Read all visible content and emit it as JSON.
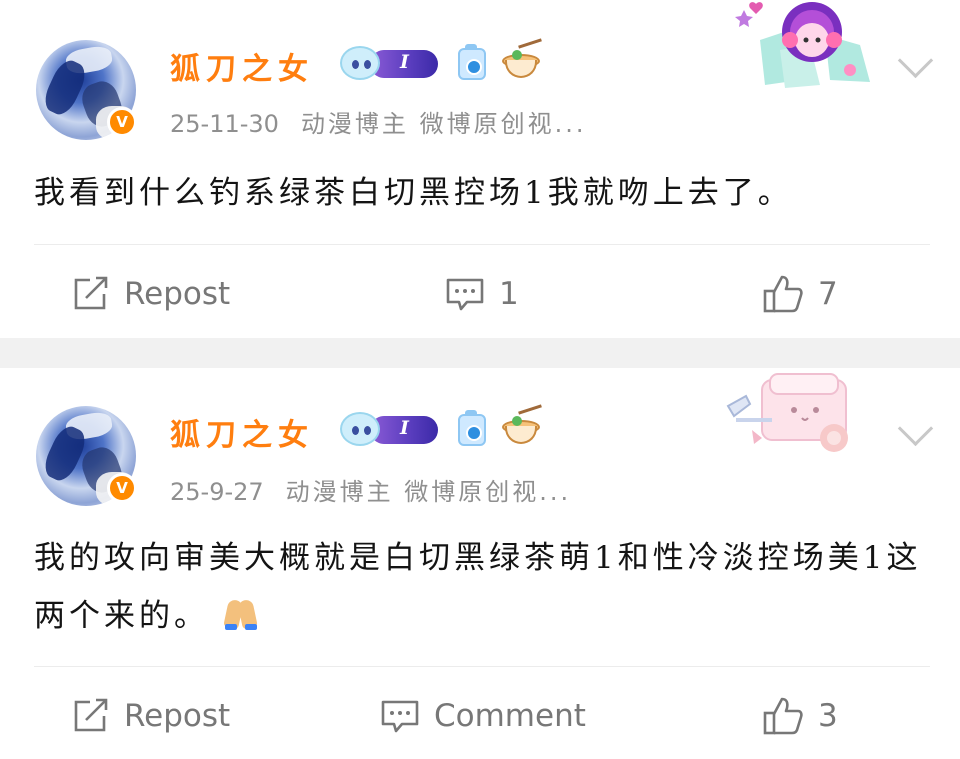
{
  "posts": [
    {
      "username": "狐刀之女",
      "level": "I",
      "date": "25-11-30",
      "source": "动漫博主 微博原创视...",
      "content": "我看到什么钓系绿茶白切黑控场1我就吻上去了。",
      "repost_label": "Repost",
      "comment_label": "1",
      "like_count": "7"
    },
    {
      "username": "狐刀之女",
      "level": "I",
      "date": "25-9-27",
      "source": "动漫博主 微博原创视...",
      "content": "我的攻向审美大概就是白切黑绿茶萌1和性冷淡控场美1这两个来的。",
      "repost_label": "Repost",
      "comment_label": "Comment",
      "like_count": "3"
    }
  ],
  "colors": {
    "username": "#ff7e0f",
    "verified_badge": "#ff8a00",
    "meta_text": "#8f8f8f",
    "action_text": "#777777",
    "divider": "#ececec",
    "separator_band": "#f1f1f1"
  },
  "icons": {
    "verified": "verified-v-icon",
    "repost": "repost-icon",
    "comment": "comment-icon",
    "like": "like-icon",
    "more": "chevron-down-icon",
    "emoji": "folded-hands-emoji-icon"
  }
}
